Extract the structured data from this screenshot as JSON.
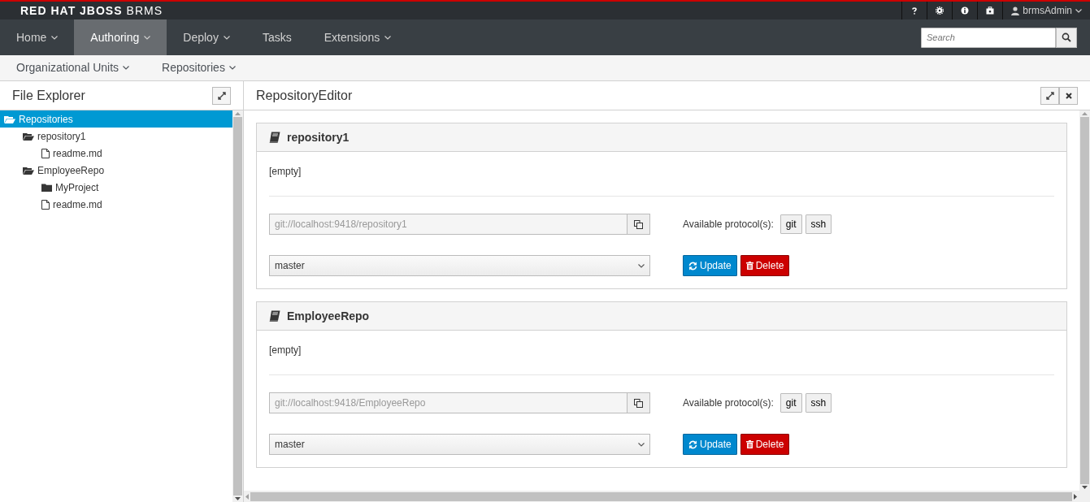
{
  "brand": {
    "title": "RED HAT JBOSS",
    "product": "BRMS"
  },
  "utility_bar": {
    "user": "brmsAdmin"
  },
  "nav": [
    {
      "label": "Home",
      "dropdown": true,
      "selected": false
    },
    {
      "label": "Authoring",
      "dropdown": true,
      "selected": true
    },
    {
      "label": "Deploy",
      "dropdown": true,
      "selected": false
    },
    {
      "label": "Tasks",
      "dropdown": false,
      "selected": false
    },
    {
      "label": "Extensions",
      "dropdown": true,
      "selected": false
    }
  ],
  "search": {
    "placeholder": "Search"
  },
  "subnav": [
    {
      "label": "Organizational Units",
      "dropdown": true
    },
    {
      "label": "Repositories",
      "dropdown": true
    }
  ],
  "file_explorer": {
    "title": "File Explorer",
    "tree": [
      {
        "label": "Repositories",
        "kind": "folder",
        "expanded": true,
        "selected": true,
        "children": [
          {
            "label": "repository1",
            "kind": "folder",
            "expanded": true,
            "selected": false,
            "children": [
              {
                "label": "readme.md",
                "kind": "file",
                "selected": false
              }
            ]
          },
          {
            "label": "EmployeeRepo",
            "kind": "folder",
            "expanded": true,
            "selected": false,
            "children": [
              {
                "label": "MyProject",
                "kind": "folder",
                "expanded": false,
                "selected": false
              },
              {
                "label": "readme.md",
                "kind": "file",
                "selected": false
              }
            ]
          }
        ]
      }
    ]
  },
  "editor": {
    "title": "RepositoryEditor",
    "repositories": [
      {
        "name": "repository1",
        "description": "[empty]",
        "url": "git://localhost:9418/repository1",
        "protocols_label": "Available protocol(s):",
        "protocols": [
          "git",
          "ssh"
        ],
        "branch": "master",
        "update": "Update",
        "delete": "Delete"
      },
      {
        "name": "EmployeeRepo",
        "description": "[empty]",
        "url": "git://localhost:9418/EmployeeRepo",
        "protocols_label": "Available protocol(s):",
        "protocols": [
          "git",
          "ssh"
        ],
        "branch": "master",
        "update": "Update",
        "delete": "Delete"
      }
    ]
  }
}
